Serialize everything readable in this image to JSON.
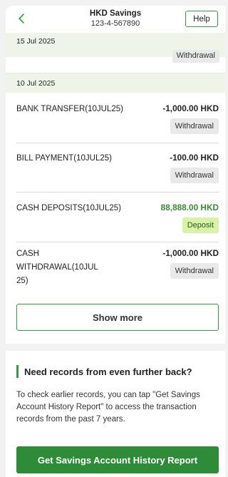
{
  "header": {
    "title": "HKD Savings",
    "account_number": "123-4-567890",
    "help_label": "Help",
    "back_icon": "chevron-left-icon"
  },
  "colors": {
    "accent_green": "#3b9a3e",
    "date_band": "#eef5e8",
    "deposit_badge": "#d8f2a8",
    "deposit_amount": "#3a8a33"
  },
  "previous_group": {
    "date": "15 Jul 2025",
    "partial_badge": "Withdrawal"
  },
  "group": {
    "date": "10 Jul 2025",
    "transactions": [
      {
        "description": "BANK TRANSFER(10JUL25)",
        "amount": "-1,000.00 HKD",
        "type": "Withdrawal"
      },
      {
        "description": "BILL PAYMENT(10JUL25)",
        "amount": "-100.00 HKD",
        "type": "Withdrawal"
      },
      {
        "description": "CASH DEPOSITS(10JUL25)",
        "amount": "88,888.00 HKD",
        "type": "Deposit"
      },
      {
        "description": "CASH WITHDRAWAL(10JUL 25)",
        "amount": "-1,000.00 HKD",
        "type": "Withdrawal"
      }
    ]
  },
  "show_more_label": "Show more",
  "records": {
    "heading": "Need records from even further back?",
    "body": "To check earlier records, you can tap \"Get Savings Account History Report\" to access the transaction records from the past 7 years.",
    "button_label": "Get Savings Account History Report"
  }
}
